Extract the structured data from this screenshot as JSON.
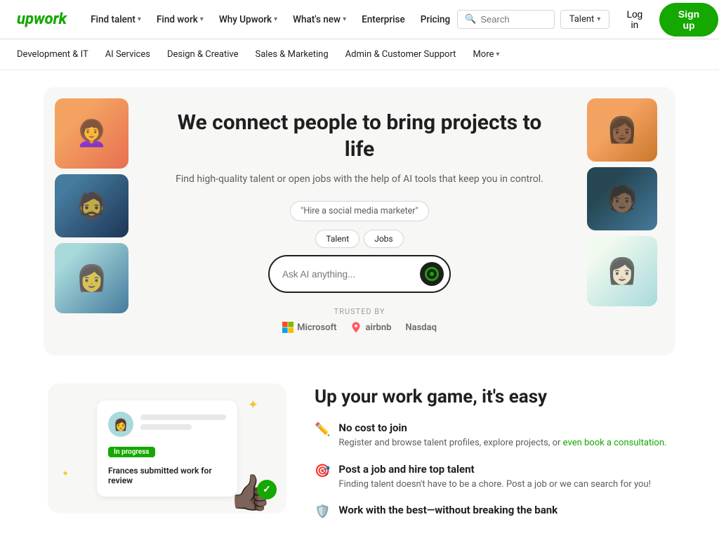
{
  "nav": {
    "logo": "upwork",
    "links": [
      {
        "id": "find-talent",
        "label": "Find talent",
        "hasChevron": true
      },
      {
        "id": "find-work",
        "label": "Find work",
        "hasChevron": true
      },
      {
        "id": "why-upwork",
        "label": "Why Upwork",
        "hasChevron": true
      },
      {
        "id": "whats-new",
        "label": "What's new",
        "hasChevron": true
      },
      {
        "id": "enterprise",
        "label": "Enterprise",
        "hasChevron": false
      },
      {
        "id": "pricing",
        "label": "Pricing",
        "hasChevron": false
      }
    ],
    "search": {
      "placeholder": "Search",
      "icon": "search"
    },
    "talent_selector": "Talent",
    "login_label": "Log in",
    "signup_label": "Sign up"
  },
  "sec_nav": {
    "items": [
      "Development & IT",
      "AI Services",
      "Design & Creative",
      "Sales & Marketing",
      "Admin & Customer Support"
    ],
    "more_label": "More"
  },
  "hero": {
    "title": "We connect people to bring projects to life",
    "subtitle": "Find high-quality talent or open jobs with the help of AI tools that keep you in control.",
    "chip_label": "\"Hire a social media marketer\"",
    "tabs": [
      {
        "label": "Talent",
        "active": false
      },
      {
        "label": "Jobs",
        "active": false
      }
    ],
    "search_placeholder": "Ask AI anything...",
    "trusted": {
      "label": "TRUSTED BY",
      "logos": [
        "Microsoft",
        "airbnb",
        "Nasdaq"
      ]
    }
  },
  "lower": {
    "card": {
      "badge": "In progress",
      "description": "Frances submitted work for review",
      "avatar_emoji": "👩"
    },
    "section_title": "Up your work game, it's easy",
    "features": [
      {
        "icon": "✏️",
        "title": "No cost to join",
        "desc": "Register and browse talent profiles, explore projects, or even book a consultation."
      },
      {
        "icon": "🎯",
        "title": "Post a job and hire top talent",
        "desc": "Finding talent doesn't have to be a chore. Post a job or we can search for you!"
      },
      {
        "icon": "🛡️",
        "title": "Work with the best—without breaking the bank",
        "desc": ""
      }
    ]
  }
}
